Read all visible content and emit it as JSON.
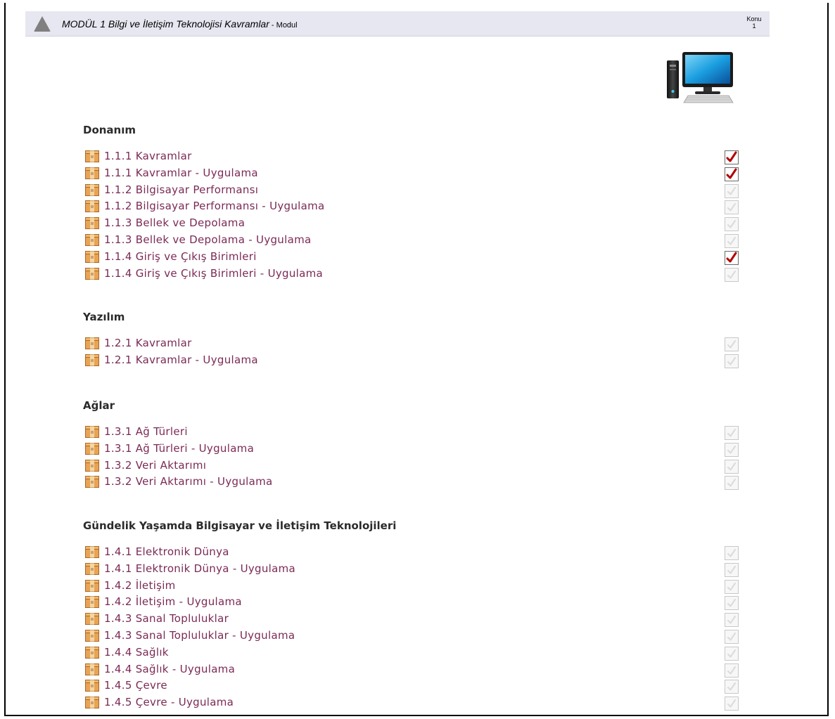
{
  "header": {
    "title": "MODÜL 1 Bilgi ve İletişim Teknolojisi Kavramlar",
    "subtitle": " - Modul",
    "konu_label": "Konu",
    "konu_value": "1"
  },
  "icons": {
    "header": "triangle-icon",
    "item": "package-icon",
    "hero": "computer-icon",
    "check": "checkbox-icon"
  },
  "colors": {
    "link": "#7b2a55",
    "check_on": "#b00000",
    "header_bg": "#e7e7f2"
  },
  "sections": [
    {
      "title": "Donanım",
      "items": [
        {
          "label": "1.1.1 Kavramlar",
          "checked": true
        },
        {
          "label": "1.1.1 Kavramlar - Uygulama",
          "checked": true
        },
        {
          "label": "1.1.2 Bilgisayar Performansı",
          "checked": false
        },
        {
          "label": "1.1.2 Bilgisayar Performansı - Uygulama",
          "checked": false
        },
        {
          "label": "1.1.3 Bellek ve Depolama",
          "checked": false
        },
        {
          "label": "1.1.3 Bellek ve Depolama - Uygulama",
          "checked": false
        },
        {
          "label": "1.1.4 Giriş ve Çıkış Birimleri",
          "checked": true
        },
        {
          "label": "1.1.4 Giriş ve Çıkış Birimleri - Uygulama",
          "checked": false
        }
      ]
    },
    {
      "title": "Yazılım",
      "items": [
        {
          "label": "1.2.1 Kavramlar",
          "checked": false
        },
        {
          "label": "1.2.1 Kavramlar - Uygulama",
          "checked": false
        }
      ]
    },
    {
      "title": "Ağlar",
      "items": [
        {
          "label": "1.3.1 Ağ Türleri",
          "checked": false
        },
        {
          "label": "1.3.1 Ağ Türleri - Uygulama",
          "checked": false
        },
        {
          "label": "1.3.2 Veri Aktarımı",
          "checked": false
        },
        {
          "label": "1.3.2 Veri Aktarımı - Uygulama",
          "checked": false
        }
      ]
    },
    {
      "title": "Gündelik Yaşamda Bilgisayar ve İletişim Teknolojileri",
      "items": [
        {
          "label": "1.4.1 Elektronik Dünya",
          "checked": false
        },
        {
          "label": "1.4.1 Elektronik Dünya - Uygulama",
          "checked": false
        },
        {
          "label": "1.4.2 İletişim",
          "checked": false
        },
        {
          "label": "1.4.2 İletişim - Uygulama",
          "checked": false
        },
        {
          "label": "1.4.3 Sanal Topluluklar",
          "checked": false
        },
        {
          "label": "1.4.3 Sanal Topluluklar - Uygulama",
          "checked": false
        },
        {
          "label": "1.4.4 Sağlık",
          "checked": false
        },
        {
          "label": "1.4.4 Sağlık - Uygulama",
          "checked": false
        },
        {
          "label": "1.4.5 Çevre",
          "checked": false
        },
        {
          "label": "1.4.5 Çevre - Uygulama",
          "checked": false
        }
      ]
    }
  ]
}
